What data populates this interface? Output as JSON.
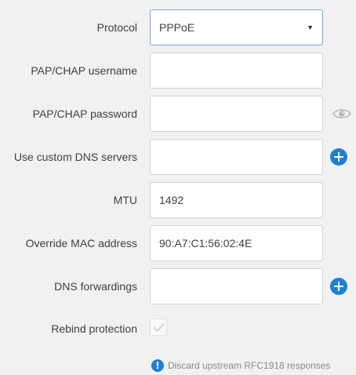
{
  "protocol": {
    "label": "Protocol",
    "value": "PPPoE"
  },
  "username": {
    "label": "PAP/CHAP username",
    "value": ""
  },
  "password": {
    "label": "PAP/CHAP password",
    "value": ""
  },
  "dns_servers": {
    "label": "Use custom DNS servers",
    "value": ""
  },
  "mtu": {
    "label": "MTU",
    "value": "1492"
  },
  "mac": {
    "label": "Override MAC address",
    "value": "90:A7:C1:56:02:4E"
  },
  "dns_forwardings": {
    "label": "DNS forwardings",
    "value": ""
  },
  "rebind": {
    "label": "Rebind protection",
    "checked": true,
    "hint": "Discard upstream RFC1918 responses"
  },
  "icons": {
    "select_arrow": "▼",
    "info": "!",
    "password_reveal": "eye-icon",
    "add": "plus-circle-icon"
  },
  "colors": {
    "accent": "#1e7fd8",
    "background": "#f1f1f1"
  }
}
